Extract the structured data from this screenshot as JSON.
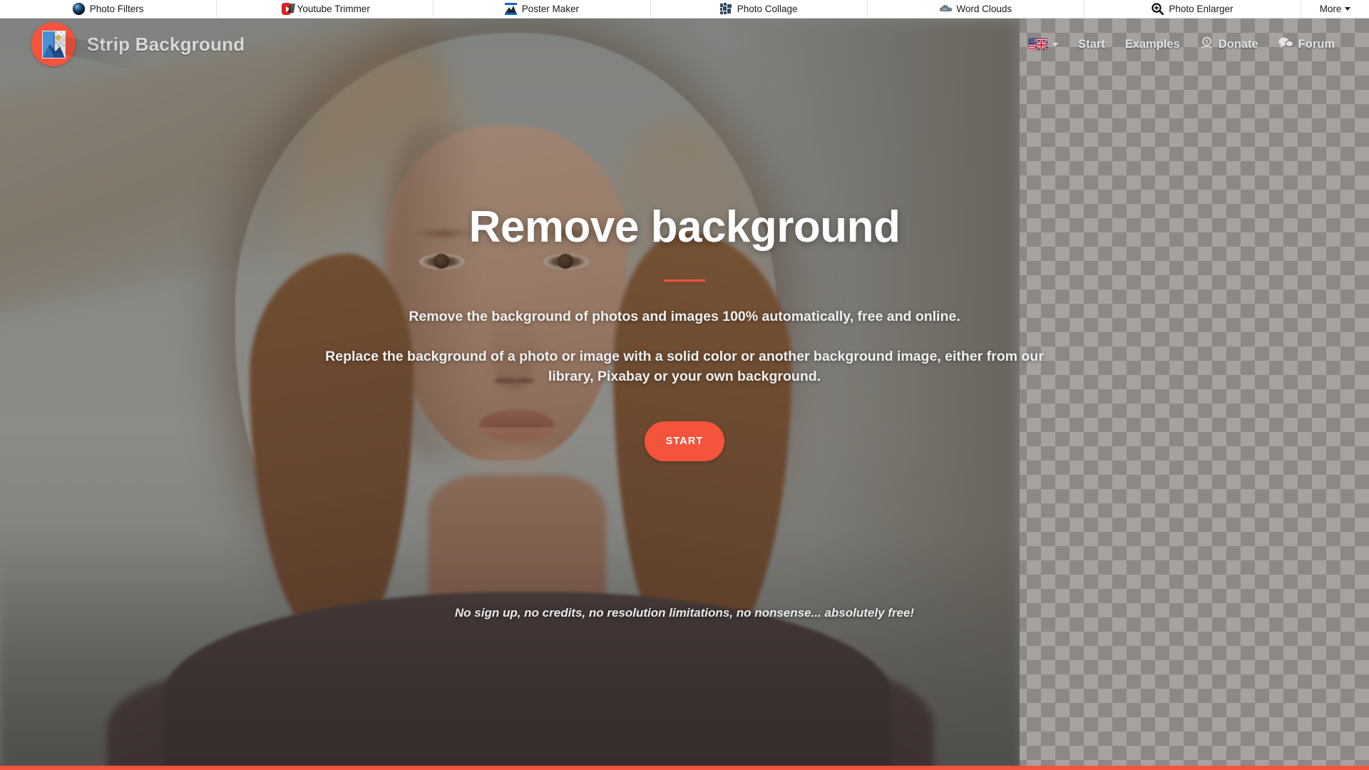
{
  "partner_bar": {
    "items": [
      {
        "label": "Photo Filters",
        "icon": "camera-lens-icon"
      },
      {
        "label": "Youtube Trimmer",
        "icon": "youtube-icon"
      },
      {
        "label": "Poster Maker",
        "icon": "poster-icon"
      },
      {
        "label": "Photo Collage",
        "icon": "collage-grid-icon"
      },
      {
        "label": "Word Clouds",
        "icon": "cloud-icon"
      },
      {
        "label": "Photo Enlarger",
        "icon": "magnifier-plus-icon"
      }
    ],
    "more_label": "More"
  },
  "header": {
    "brand_title": "Strip Background",
    "brand_icon": "image-placeholder-icon",
    "language": {
      "icon": "uk-us-flag-icon",
      "caret": "chevron-down-icon"
    },
    "nav": [
      {
        "label": "Start",
        "icon": null
      },
      {
        "label": "Examples",
        "icon": null
      },
      {
        "label": "Donate",
        "icon": "donate-money-icon"
      },
      {
        "label": "Forum",
        "icon": "chat-bubbles-icon"
      }
    ]
  },
  "hero": {
    "title": "Remove background",
    "subtitle_1": "Remove the background of photos and images 100% automatically, free and online.",
    "subtitle_2": "Replace the background of a photo or image with a solid color or another background image, either from our library, Pixabay or your own background.",
    "start_label": "START",
    "tagline": "No sign up, no credits, no resolution limitations, no nonsense... absolutely free!"
  },
  "colors": {
    "accent": "#f4533c",
    "partner_bar_bg": "#ffffff",
    "hero_text": "#ffffff",
    "brand_text": "#d9d9d9"
  }
}
